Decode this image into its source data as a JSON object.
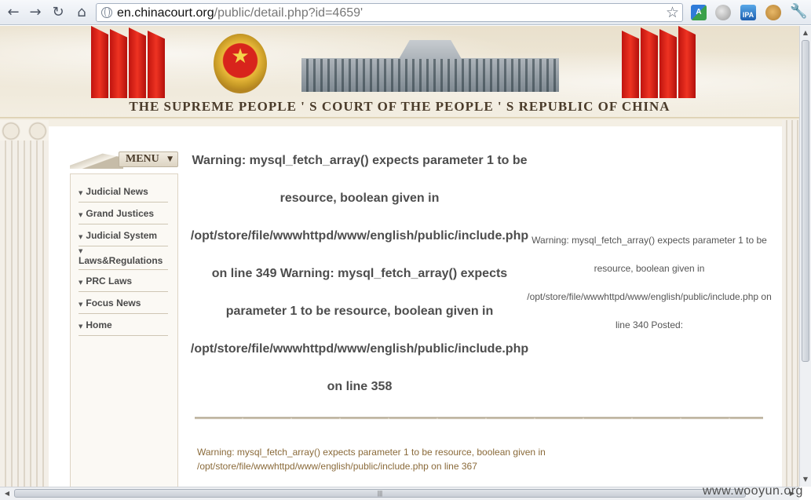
{
  "browser": {
    "url_host": "en.chinacourt.org",
    "url_path": "/public/detail.php?id=4659'",
    "back_label": "←",
    "forward_label": "→",
    "reload_label": "↻",
    "home_label": "⌂",
    "star_label": "☆",
    "wrench_label": "🔧",
    "ipa_label": "IPA",
    "translate_label": "A"
  },
  "banner": {
    "title": "THE SUPREME PEOPLE ' S COURT OF THE PEOPLE ' S REPUBLIC OF CHINA"
  },
  "menu": {
    "title": "MENU",
    "caret": "▼",
    "items": [
      {
        "label": "Judicial News"
      },
      {
        "label": "Grand Justices"
      },
      {
        "label": "Judicial System"
      },
      {
        "label": "Laws&Regulations"
      },
      {
        "label": "PRC Laws"
      },
      {
        "label": "Focus News"
      },
      {
        "label": "Home"
      }
    ],
    "arrow": "▼"
  },
  "main": {
    "warning_big": "Warning: mysql_fetch_array() expects parameter 1 to be resource, boolean given in /opt/store/file/wwwhttpd/www/english/public/include.php on line 349 Warning: mysql_fetch_array() expects parameter 1 to be resource, boolean given in /opt/store/file/wwwhttpd/www/english/public/include.php on line 358",
    "warning_side": "Warning: mysql_fetch_array() expects parameter 1 to be resource, boolean given in /opt/store/file/wwwhttpd/www/english/public/include.php on line 340 Posted:",
    "warning_foot": "Warning: mysql_fetch_array() expects parameter 1 to be resource, boolean given in /opt/store/file/wwwhttpd/www/english/public/include.php on line 367"
  },
  "scroll": {
    "up": "▲",
    "down": "▼",
    "left": "◀",
    "right": "▶",
    "grip": "|||"
  },
  "watermark": "www.wooyun.org",
  "colors": {
    "flag_red": "#d8241c",
    "menu_text": "#4a4a4a",
    "warning_text": "#4d4d4d",
    "foot_text": "#8a6a3a"
  }
}
